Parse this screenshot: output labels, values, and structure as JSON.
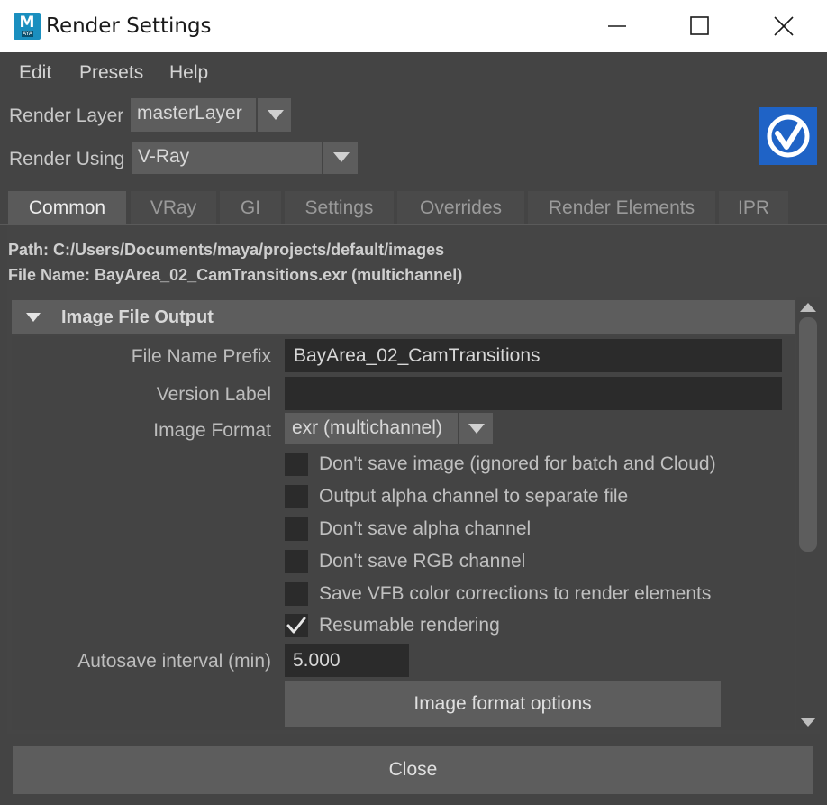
{
  "window": {
    "app_icon_letter": "M",
    "app_icon_sub": "AYA",
    "title": "Render Settings"
  },
  "menu": [
    "Edit",
    "Presets",
    "Help"
  ],
  "render_layer": {
    "label": "Render Layer",
    "value": "masterLayer"
  },
  "render_using": {
    "label": "Render Using",
    "value": "V-Ray"
  },
  "tabs": [
    {
      "label": "Common",
      "active": true
    },
    {
      "label": "VRay",
      "active": false
    },
    {
      "label": "GI",
      "active": false
    },
    {
      "label": "Settings",
      "active": false
    },
    {
      "label": "Overrides",
      "active": false
    },
    {
      "label": "Render Elements",
      "active": false
    },
    {
      "label": "IPR",
      "active": false
    }
  ],
  "path_line": "Path: C:/Users/Documents/maya/projects/default/images",
  "file_name_line": "File Name: BayArea_02_CamTransitions.exr (multichannel)",
  "section": {
    "title": "Image File Output",
    "file_name_prefix": {
      "label": "File Name Prefix",
      "value": "BayArea_02_CamTransitions"
    },
    "version_label": {
      "label": "Version Label",
      "value": ""
    },
    "image_format": {
      "label": "Image Format",
      "value": "exr (multichannel)"
    },
    "checkboxes": [
      {
        "label": "Don't save image (ignored for batch and Cloud)",
        "checked": false
      },
      {
        "label": "Output alpha channel to separate file",
        "checked": false
      },
      {
        "label": "Don't save alpha channel",
        "checked": false
      },
      {
        "label": "Don't save RGB channel",
        "checked": false
      },
      {
        "label": "Save VFB color corrections to render elements",
        "checked": false
      },
      {
        "label": "Resumable rendering",
        "checked": true
      }
    ],
    "autosave": {
      "label": "Autosave interval (min)",
      "value": "5.000"
    },
    "options_button": "Image format options"
  },
  "close_button": "Close",
  "colors": {
    "background": "#444444",
    "panel": "#5d5d5d",
    "field": "#2b2b2b",
    "vray_blue": "#1f63c6"
  }
}
